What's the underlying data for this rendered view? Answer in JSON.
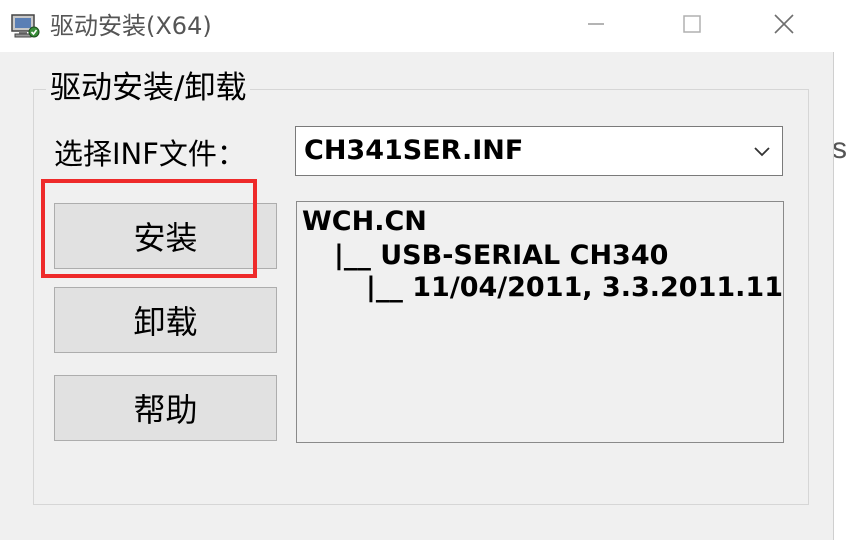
{
  "window": {
    "title": "驱动安装(X64)"
  },
  "group": {
    "label": "驱动安装/卸载"
  },
  "inf_select": {
    "label": "选择INF文件：",
    "selected": "CH341SER.INF"
  },
  "buttons": {
    "install": "安装",
    "uninstall": "卸载",
    "help": "帮助"
  },
  "info": {
    "lines": [
      "WCH.CN",
      "|__ USB-SERIAL CH340",
      "|__ 11/04/2011, 3.3.2011.11"
    ]
  },
  "outside": {
    "glyph": "s"
  },
  "colors": {
    "highlight": "#ee2a2a",
    "window_bg": "#f0f0f0",
    "button_bg": "#e1e1e1"
  },
  "icons": {
    "app": "driver-install-icon",
    "minimize": "minimize-icon",
    "maximize": "maximize-icon",
    "close": "close-icon",
    "dropdown": "chevron-down-icon"
  }
}
